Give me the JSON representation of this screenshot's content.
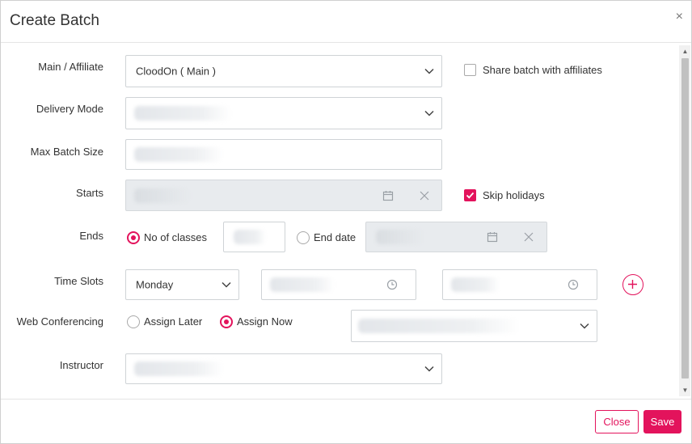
{
  "dialog": {
    "title": "Create Batch",
    "close_glyph": "×"
  },
  "form": {
    "main_affiliate": {
      "label": "Main / Affiliate",
      "value": "CloodOn ( Main )"
    },
    "share_batch": {
      "label": "Share batch with affiliates",
      "checked": false
    },
    "delivery_mode": {
      "label": "Delivery Mode",
      "value": ""
    },
    "max_batch_size": {
      "label": "Max Batch Size",
      "value": ""
    },
    "starts": {
      "label": "Starts",
      "value": "",
      "calendar_icon": "calendar-icon",
      "clear_icon": "close-icon"
    },
    "skip_holidays": {
      "label": "Skip holidays",
      "checked": true
    },
    "ends": {
      "label": "Ends",
      "option_classes": "No of classes",
      "option_date": "End date",
      "selected": "No of classes"
    },
    "time_slots": {
      "label": "Time Slots",
      "day": "Monday",
      "clock_icon": "clock-icon",
      "add_icon": "plus-icon"
    },
    "web_conferencing": {
      "label": "Web Conferencing",
      "option_later": "Assign Later",
      "option_now": "Assign Now",
      "selected": "Assign Now"
    },
    "instructor": {
      "label": "Instructor",
      "value": ""
    }
  },
  "footer": {
    "close_label": "Close",
    "save_label": "Save"
  },
  "colors": {
    "accent": "#e3135c",
    "disabled_bg": "#e8ebee",
    "border": "#cfd3d6"
  }
}
